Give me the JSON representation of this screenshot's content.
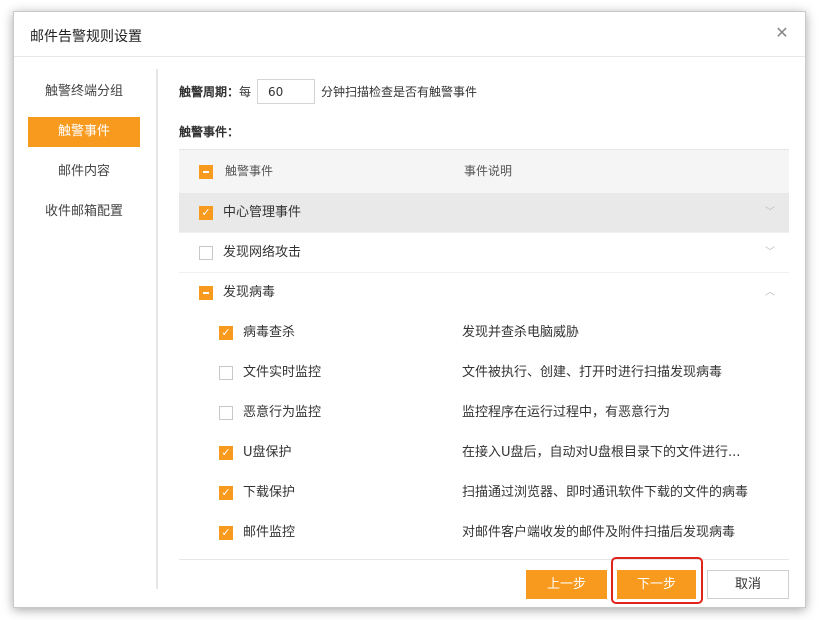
{
  "dialog": {
    "title": "邮件告警规则设置"
  },
  "nav": {
    "items": [
      {
        "label": "触警终端分组",
        "active": false
      },
      {
        "label": "触警事件",
        "active": true
      },
      {
        "label": "邮件内容",
        "active": false
      },
      {
        "label": "收件邮箱配置",
        "active": false
      }
    ]
  },
  "period": {
    "label": "触警周期：",
    "prefix": "每",
    "value": "60",
    "suffix": "分钟扫描检查是否有触警事件"
  },
  "events_label": "触警事件：",
  "table": {
    "header": {
      "name": "触警事件",
      "desc": "事件说明"
    },
    "groups": [
      {
        "name": "中心管理事件",
        "state": "checked",
        "expanded": false
      },
      {
        "name": "发现网络攻击",
        "state": "unchecked",
        "expanded": false
      },
      {
        "name": "发现病毒",
        "state": "partial",
        "expanded": true
      }
    ],
    "children": [
      {
        "name": "病毒查杀",
        "desc": "发现并查杀电脑威胁",
        "checked": true
      },
      {
        "name": "文件实时监控",
        "desc": "文件被执行、创建、打开时进行扫描发现病毒",
        "checked": false
      },
      {
        "name": "恶意行为监控",
        "desc": "监控程序在运行过程中，有恶意行为",
        "checked": false
      },
      {
        "name": "U盘保护",
        "desc": "在接入U盘后，自动对U盘根目录下的文件进行...",
        "checked": true
      },
      {
        "name": "下载保护",
        "desc": "扫描通过浏览器、即时通讯软件下载的文件的病毒",
        "checked": true
      },
      {
        "name": "邮件监控",
        "desc": "对邮件客户端收发的邮件及附件扫描后发现病毒",
        "checked": true
      }
    ]
  },
  "buttons": {
    "prev": "上一步",
    "next": "下一步",
    "cancel": "取消"
  },
  "icons": {
    "close": "close-icon",
    "chevron_down": "chevron-down-icon",
    "chevron_up": "chevron-up-icon",
    "check": "check-icon"
  },
  "colors": {
    "accent": "#f79a1e",
    "highlight_border": "#e0241c"
  }
}
